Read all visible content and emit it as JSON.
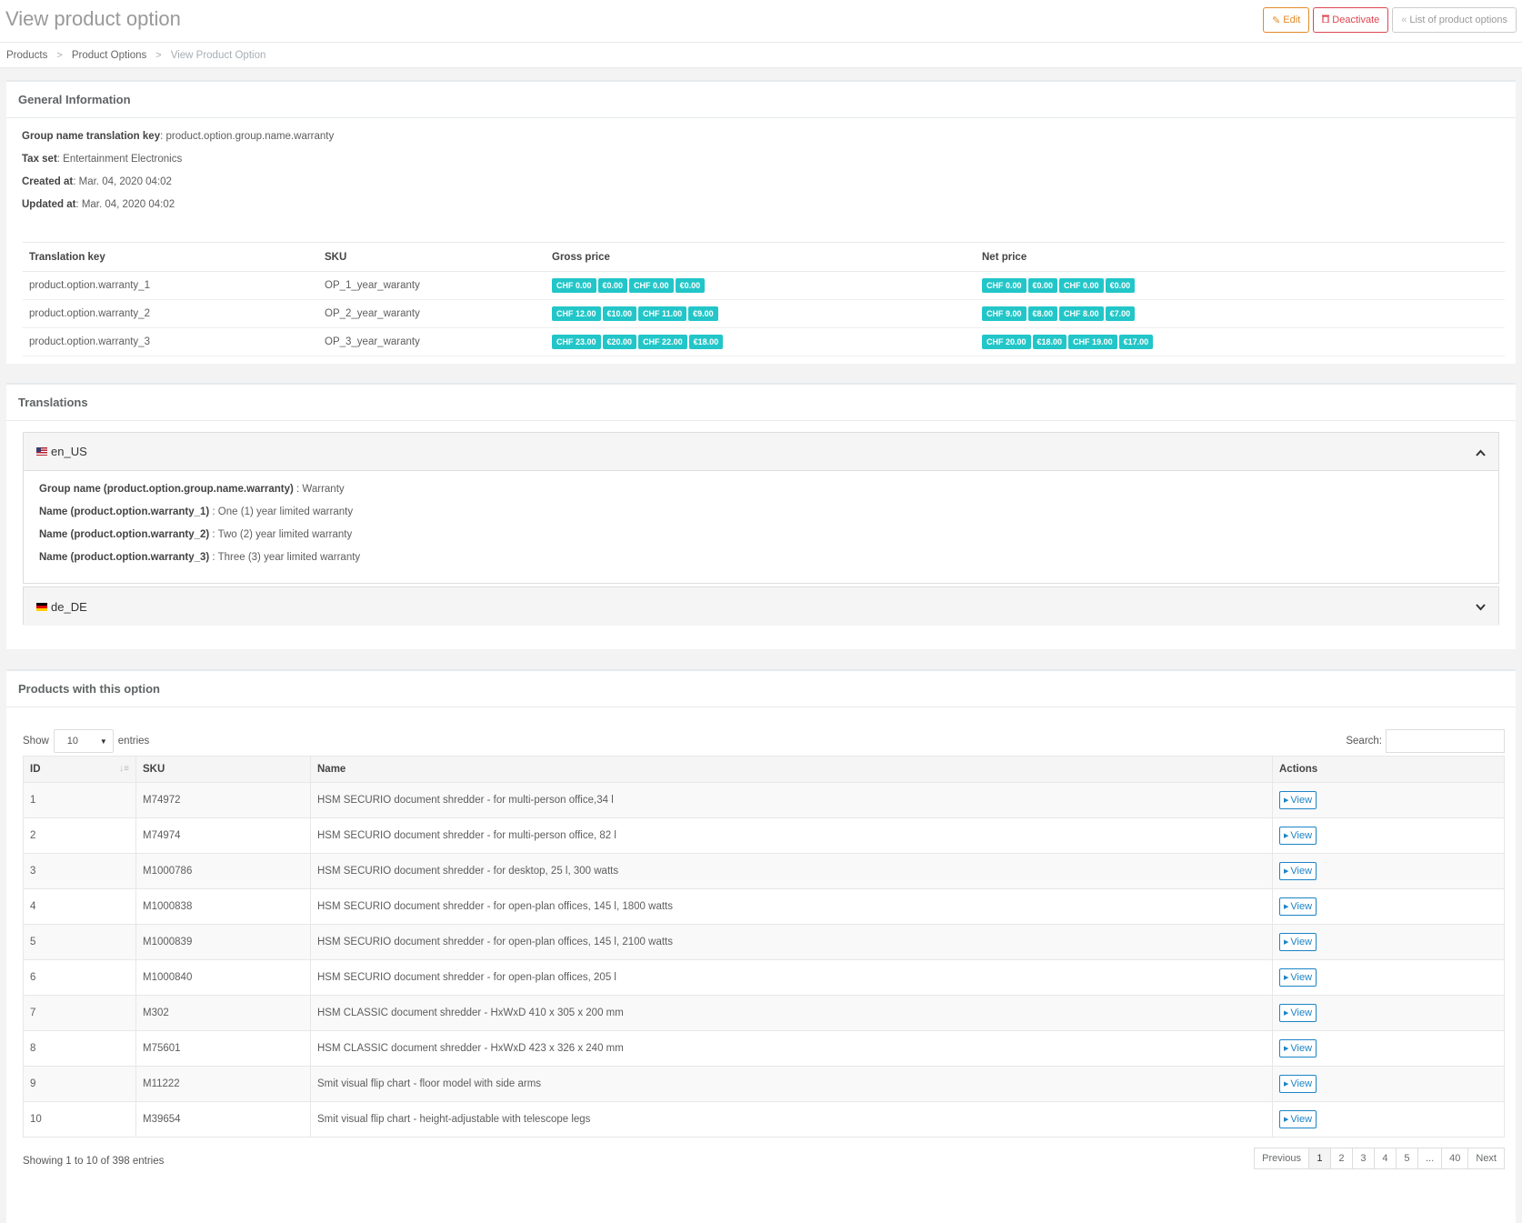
{
  "header": {
    "title": "View product option",
    "actions": [
      {
        "icon": "edit-icon",
        "glyph": "✎",
        "label": "Edit"
      },
      {
        "icon": "trash-icon",
        "glyph": "🗑",
        "label": "Deactivate"
      },
      {
        "icon": "double-chevron-left-icon",
        "glyph": "«",
        "label": "List of product options"
      }
    ]
  },
  "breadcrumb": {
    "items": [
      "Products",
      "Product Options",
      "View Product Option"
    ]
  },
  "general": {
    "title": "General Information",
    "fields": [
      {
        "label": "Group name translation key",
        "value": "product.option.group.name.warranty"
      },
      {
        "label": "Tax set",
        "value": "Entertainment Electronics"
      },
      {
        "label": "Created at",
        "value": "Mar. 04, 2020 04:02"
      },
      {
        "label": "Updated at",
        "value": "Mar. 04, 2020 04:02"
      }
    ],
    "table": {
      "headers": [
        "Translation key",
        "SKU",
        "Gross price",
        "Net price"
      ],
      "rows": [
        {
          "key": "product.option.warranty_1",
          "sku": "OP_1_year_waranty",
          "gross": [
            "CHF 0.00",
            "€0.00",
            "CHF 0.00",
            "€0.00"
          ],
          "net": [
            "CHF 0.00",
            "€0.00",
            "CHF 0.00",
            "€0.00"
          ]
        },
        {
          "key": "product.option.warranty_2",
          "sku": "OP_2_year_waranty",
          "gross": [
            "CHF 12.00",
            "€10.00",
            "CHF 11.00",
            "€9.00"
          ],
          "net": [
            "CHF 9.00",
            "€8.00",
            "CHF 8.00",
            "€7.00"
          ]
        },
        {
          "key": "product.option.warranty_3",
          "sku": "OP_3_year_waranty",
          "gross": [
            "CHF 23.00",
            "€20.00",
            "CHF 22.00",
            "€18.00"
          ],
          "net": [
            "CHF 20.00",
            "€18.00",
            "CHF 19.00",
            "€17.00"
          ]
        }
      ]
    }
  },
  "translations": {
    "title": "Translations",
    "locales": [
      {
        "name": "en_US",
        "flag": "us-flag-icon",
        "expanded": true,
        "lines": [
          {
            "label": "Group name (product.option.group.name.warranty)",
            "value": " : Warranty"
          },
          {
            "label": "Name (product.option.warranty_1)",
            "value": " : One (1) year limited warranty"
          },
          {
            "label": "Name (product.option.warranty_2)",
            "value": " : Two (2) year limited warranty"
          },
          {
            "label": "Name (product.option.warranty_3)",
            "value": " : Three (3) year limited warranty"
          }
        ]
      },
      {
        "name": "de_DE",
        "flag": "de-flag-icon",
        "expanded": false,
        "lines": []
      }
    ]
  },
  "products": {
    "title": "Products with this option",
    "show_label": "Show",
    "entries_label": "entries",
    "page_length": "10",
    "search_label": "Search:",
    "search_value": "",
    "headers": [
      "ID",
      "SKU",
      "Name",
      "Actions"
    ],
    "view_label": "View",
    "rows": [
      {
        "id": "1",
        "sku": "M74972",
        "name": "HSM SECURIO document shredder - for multi-person office,34 l"
      },
      {
        "id": "2",
        "sku": "M74974",
        "name": "HSM SECURIO document shredder - for multi-person office, 82 l"
      },
      {
        "id": "3",
        "sku": "M1000786",
        "name": "HSM SECURIO document shredder - for desktop, 25 l, 300 watts"
      },
      {
        "id": "4",
        "sku": "M1000838",
        "name": "HSM SECURIO document shredder - for open-plan offices, 145 l, 1800 watts"
      },
      {
        "id": "5",
        "sku": "M1000839",
        "name": "HSM SECURIO document shredder - for open-plan offices, 145 l, 2100 watts"
      },
      {
        "id": "6",
        "sku": "M1000840",
        "name": "HSM SECURIO document shredder - for open-plan offices, 205 l"
      },
      {
        "id": "7",
        "sku": "M302",
        "name": "HSM CLASSIC document shredder - HxWxD 410 x 305 x 200 mm"
      },
      {
        "id": "8",
        "sku": "M75601",
        "name": "HSM CLASSIC document shredder - HxWxD 423 x 326 x 240 mm"
      },
      {
        "id": "9",
        "sku": "M11222",
        "name": "Smit visual flip chart - floor model with side arms"
      },
      {
        "id": "10",
        "sku": "M39654",
        "name": "Smit visual flip chart - height-adjustable with telescope legs"
      }
    ],
    "info": "Showing 1 to 10 of 398 entries",
    "pagination": [
      "Previous",
      "1",
      "2",
      "3",
      "4",
      "5",
      "...",
      "40",
      "Next"
    ],
    "current_page": "1"
  },
  "colors": {
    "badge": "#23c6c8",
    "edit": "#e48a25",
    "deactivate": "#e0454f",
    "view": "#1c84c6"
  }
}
